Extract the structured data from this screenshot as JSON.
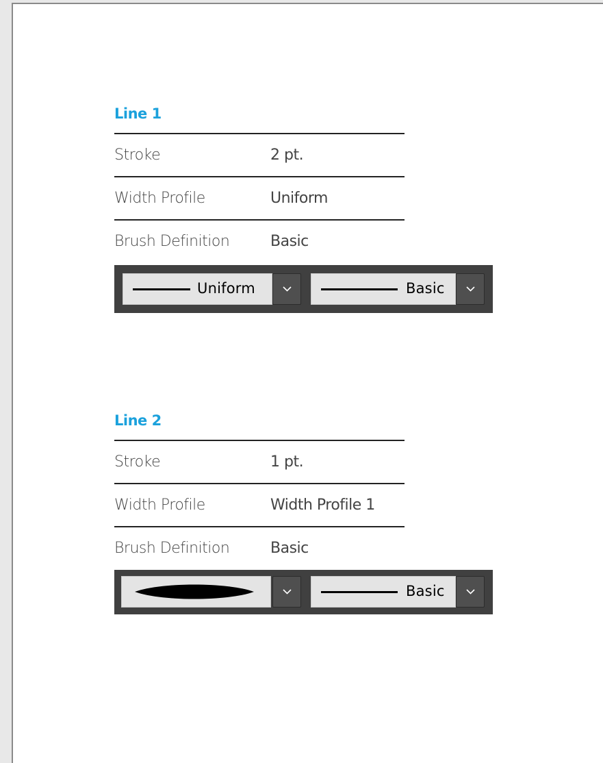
{
  "sections": [
    {
      "title": "Line 1",
      "rows": [
        {
          "label": "Stroke",
          "value": "2 pt."
        },
        {
          "label": "Width Profile",
          "value": "Uniform"
        },
        {
          "label": "Brush Definition",
          "value": "Basic"
        }
      ],
      "toolbar": {
        "profile_dropdown": {
          "icon": "uniform-line-icon",
          "label": "Uniform"
        },
        "brush_dropdown": {
          "icon": "basic-line-icon",
          "label": "Basic"
        }
      }
    },
    {
      "title": "Line 2",
      "rows": [
        {
          "label": "Stroke",
          "value": "1 pt."
        },
        {
          "label": "Width Profile",
          "value": "Width Profile 1"
        },
        {
          "label": "Brush Definition",
          "value": "Basic"
        }
      ],
      "toolbar": {
        "profile_dropdown": {
          "icon": "width-profile-1-icon",
          "label": ""
        },
        "brush_dropdown": {
          "icon": "basic-line-icon",
          "label": "Basic"
        }
      }
    }
  ],
  "colors": {
    "title": "#1ba1dc",
    "toolbar_bg": "#404040",
    "field_bg": "#e4e4e4"
  }
}
